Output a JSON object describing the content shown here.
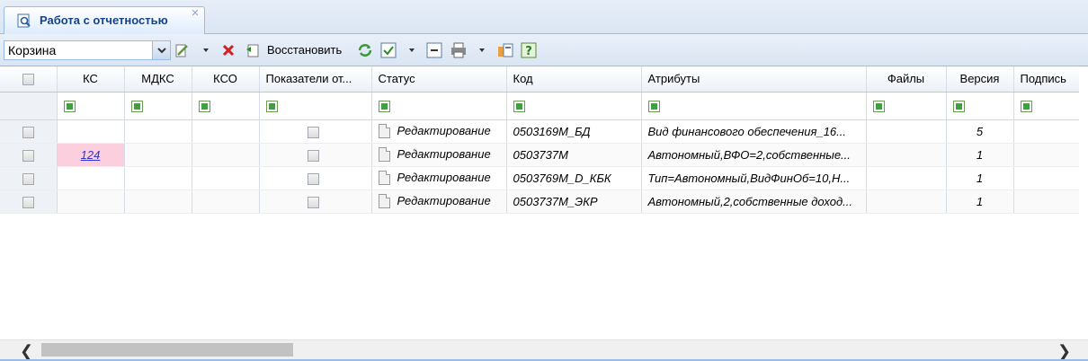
{
  "tab": {
    "title": "Работа с отчетностью",
    "close_glyph": "✕",
    "icon": "report-search-icon"
  },
  "toolbar": {
    "filter_value": "Корзина",
    "restore_label": "Восстановить",
    "icons": [
      "edit-icon",
      "delete-icon",
      "restore-icon",
      "refresh-icon",
      "check-icon",
      "collapse-icon",
      "print-icon",
      "export-icon",
      "help-icon"
    ]
  },
  "columns": [
    "",
    "КС",
    "МДКС",
    "КСО",
    "Показатели от...",
    "Статус",
    "Код",
    "Атрибуты",
    "Файлы",
    "Версия",
    "Подпись"
  ],
  "rows": [
    {
      "ks": "",
      "status": "Редактирование",
      "code": "0503169M_БД",
      "attrs": "Вид финансового обеспечения_16...",
      "files": "",
      "version": "5"
    },
    {
      "ks": "124",
      "status": "Редактирование",
      "code": "0503737M",
      "attrs": "Автономный,ВФО=2,собственные...",
      "files": "",
      "version": "1"
    },
    {
      "ks": "",
      "status": "Редактирование",
      "code": "0503769M_D_КБК",
      "attrs": "Тип=Автономный,ВидФинОб=10,Н...",
      "files": "",
      "version": "1"
    },
    {
      "ks": "",
      "status": "Редактирование",
      "code": "0503737M_ЭКР",
      "attrs": "Автономный,2,собственные доход...",
      "files": "",
      "version": "1"
    }
  ],
  "colors": {
    "accent": "#99bce8",
    "title": "#15428b",
    "highlight": "#fccfdf",
    "link": "#3333cc"
  }
}
